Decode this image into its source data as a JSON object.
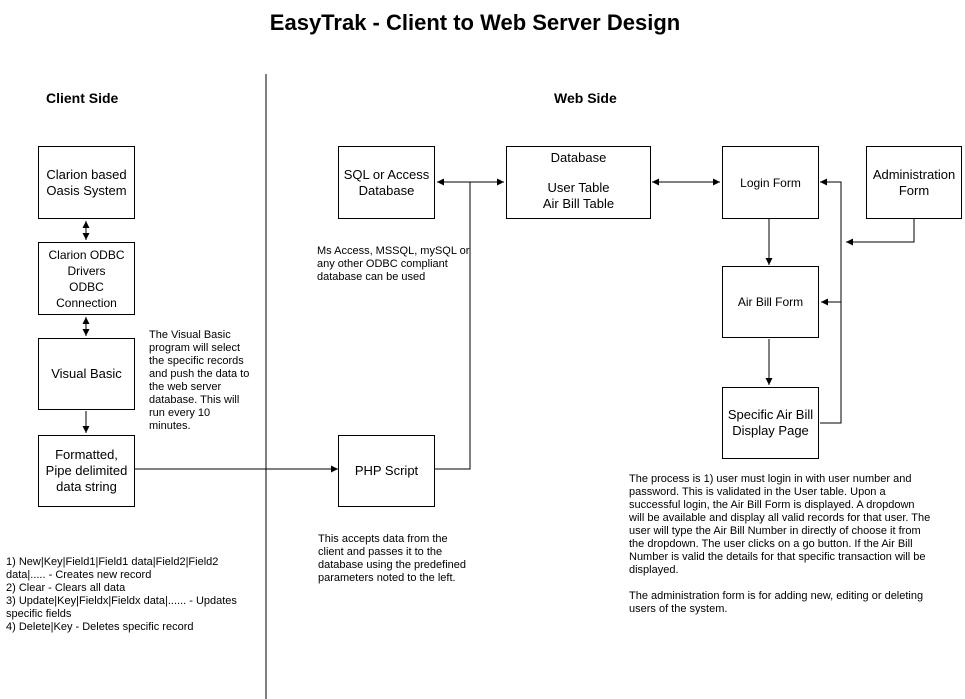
{
  "title": "EasyTrak - Client to Web Server Design",
  "sections": {
    "client": "Client Side",
    "web": "Web Side"
  },
  "boxes": {
    "clarion_oasis": [
      "Clarion based",
      "Oasis System"
    ],
    "odbc_drivers": [
      "Clarion ODBC",
      "Drivers",
      "ODBC",
      "Connection"
    ],
    "visual_basic": [
      "Visual Basic"
    ],
    "pipe_string": [
      "Formatted,",
      "Pipe delimited",
      "data string"
    ],
    "sql_access": [
      "SQL or Access",
      "Database"
    ],
    "php_script": [
      "PHP Script"
    ],
    "database": {
      "title": "Database",
      "tables": [
        "User Table",
        "Air Bill Table"
      ]
    },
    "login_form": [
      "Login Form"
    ],
    "admin_form": [
      "Administration",
      "Form"
    ],
    "air_bill_form": [
      "Air Bill Form"
    ],
    "specific_air_bill": [
      "Specific Air Bill",
      "Display Page"
    ]
  },
  "notes": {
    "vb_note": [
      "The Visual Basic",
      "program will select",
      "the specific records",
      "and push the data to",
      "the web server",
      "database.  This will",
      "run every 10",
      "minutes."
    ],
    "db_note": [
      "Ms Access, MSSQL, mySQL or",
      "any other ODBC compliant",
      "database can be used"
    ],
    "php_note": [
      "This accepts data from the",
      "client and passes it to the",
      "database using the predefined",
      "parameters noted to the left."
    ],
    "commands": [
      "1) New|Key|Field1|Field1 data|Field2|Field2",
      "data|..... - Creates new record",
      "2) Clear - Clears all data",
      "3) Update|Key|Fieldx|Fieldx data|...... - Updates",
      "specific fields",
      "4) Delete|Key - Deletes specific record"
    ],
    "process": [
      "The process is 1) user must login in with user number and",
      "password.  This is validated in the User table.  Upon a",
      "successful login, the Air Bill Form is displayed.  A dropdown",
      "will be available and display all valid records for that user.  The",
      "user will type the Air Bill Number in directly of choose it from",
      "the dropdown.  The user clicks on a go button.  If the Air Bill",
      "Number is valid the details for that specific transaction will be",
      "displayed."
    ],
    "admin": [
      "The administration form is for adding new, editing or deleting",
      "users of the system."
    ]
  }
}
